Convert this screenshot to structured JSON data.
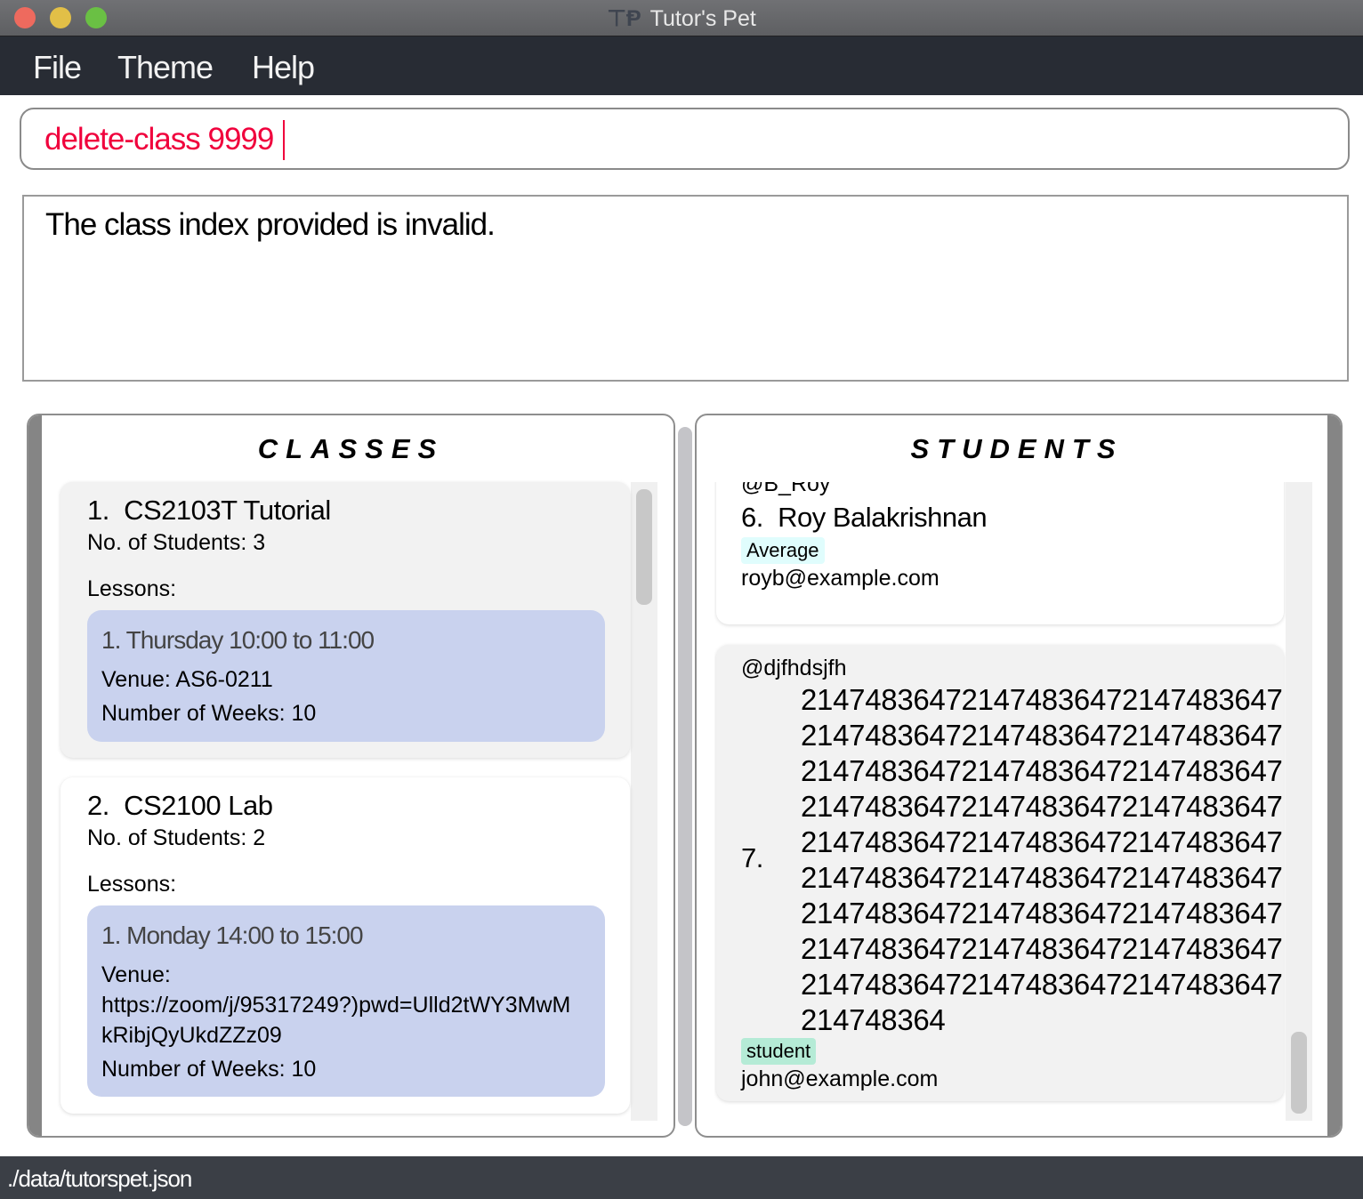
{
  "window": {
    "title": "Tutor's Pet",
    "logo": "TP"
  },
  "menu": [
    "File",
    "Theme",
    "Help"
  ],
  "command": {
    "value": "delete-class 9999"
  },
  "result": {
    "text": "The class index provided is invalid."
  },
  "classes": {
    "header": "CLASSES",
    "items": [
      {
        "index": "1.",
        "name": "CS2103T Tutorial",
        "students_label": "No. of Students:",
        "students": "3",
        "lessons_label": "Lessons:",
        "lesson": {
          "title": "1. Thursday 10:00 to 11:00",
          "venue": "Venue: AS6-0211",
          "weeks": "Number of Weeks: 10"
        }
      },
      {
        "index": "2.",
        "name": "CS2100 Lab",
        "students_label": "No. of Students:",
        "students": "2",
        "lessons_label": "Lessons:",
        "lesson": {
          "title": "1. Monday 14:00 to 15:00",
          "venue_label": "Venue:",
          "venue_line1": "https://zoom/j/95317249?)pwd=Ulld2tWY3MwM",
          "venue_line2": "kRibjQyUkdZZz09",
          "weeks": "Number of Weeks: 10"
        }
      }
    ]
  },
  "students": {
    "header": "STUDENTS",
    "items": [
      {
        "telegram": "@B_Roy",
        "index": "6.",
        "name": "Roy Balakrishnan",
        "tag": "Average",
        "tag_color": "#e0fdfd",
        "email": "royb@example.com"
      },
      {
        "telegram": "@djfhdsjfh",
        "index": "7.",
        "name_lines": [
          "214748364721474836472147483647",
          "214748364721474836472147483647",
          "214748364721474836472147483647",
          "214748364721474836472147483647",
          "214748364721474836472147483647",
          "214748364721474836472147483647",
          "214748364721474836472147483647",
          "214748364721474836472147483647",
          "214748364721474836472147483647",
          "214748364"
        ],
        "tag": "student",
        "tag_color": "#b5ebd6",
        "email": "john@example.com"
      }
    ]
  },
  "status": {
    "path": "./data/tutorspet.json"
  }
}
